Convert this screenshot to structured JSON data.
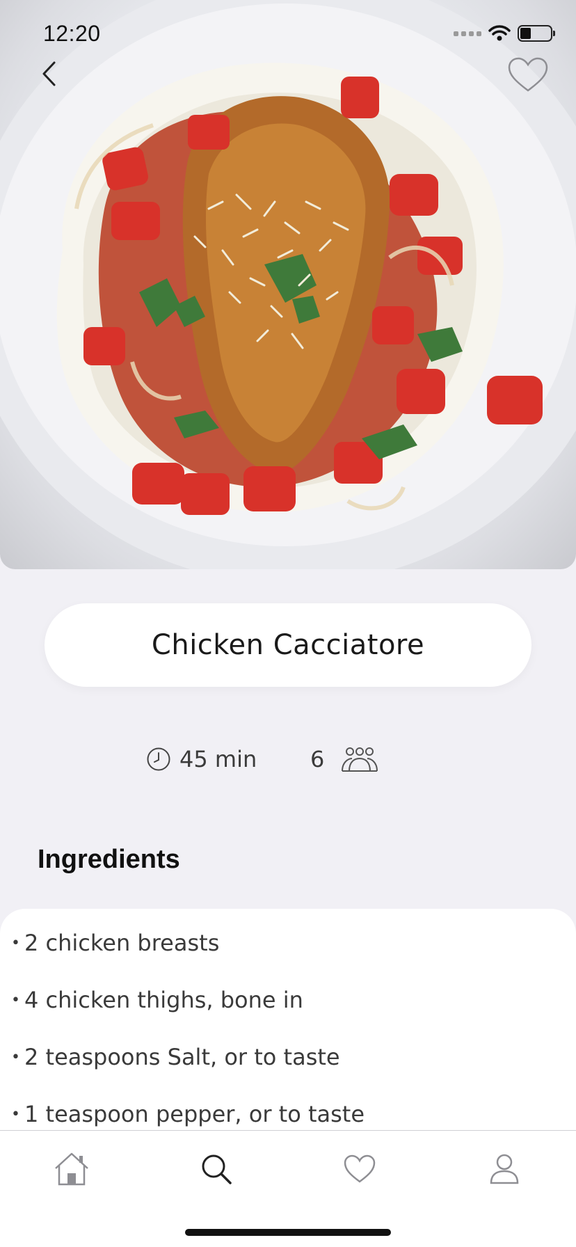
{
  "status_bar": {
    "time": "12:20"
  },
  "header": {
    "back_icon": "chevron-left-icon",
    "favorite_icon": "heart-outline-icon"
  },
  "recipe": {
    "title": "Chicken Cacciatore",
    "time": "45 min",
    "servings": "6",
    "time_icon": "clock-icon",
    "servings_icon": "people-icon"
  },
  "ingredients": {
    "heading": "Ingredients",
    "bullet": "•",
    "items": [
      "2 chicken breasts",
      "4 chicken thighs, bone in",
      "2 teaspoons Salt, or to taste",
      "1 teaspoon pepper, or to taste"
    ]
  },
  "tabbar": {
    "tabs": [
      "home-icon",
      "search-icon",
      "heart-icon",
      "profile-icon"
    ]
  },
  "colors": {
    "background": "#f1f0f5",
    "card": "#ffffff",
    "text": "#111111",
    "muted_text": "#3a3a3a",
    "icon": "#8e8e93"
  }
}
